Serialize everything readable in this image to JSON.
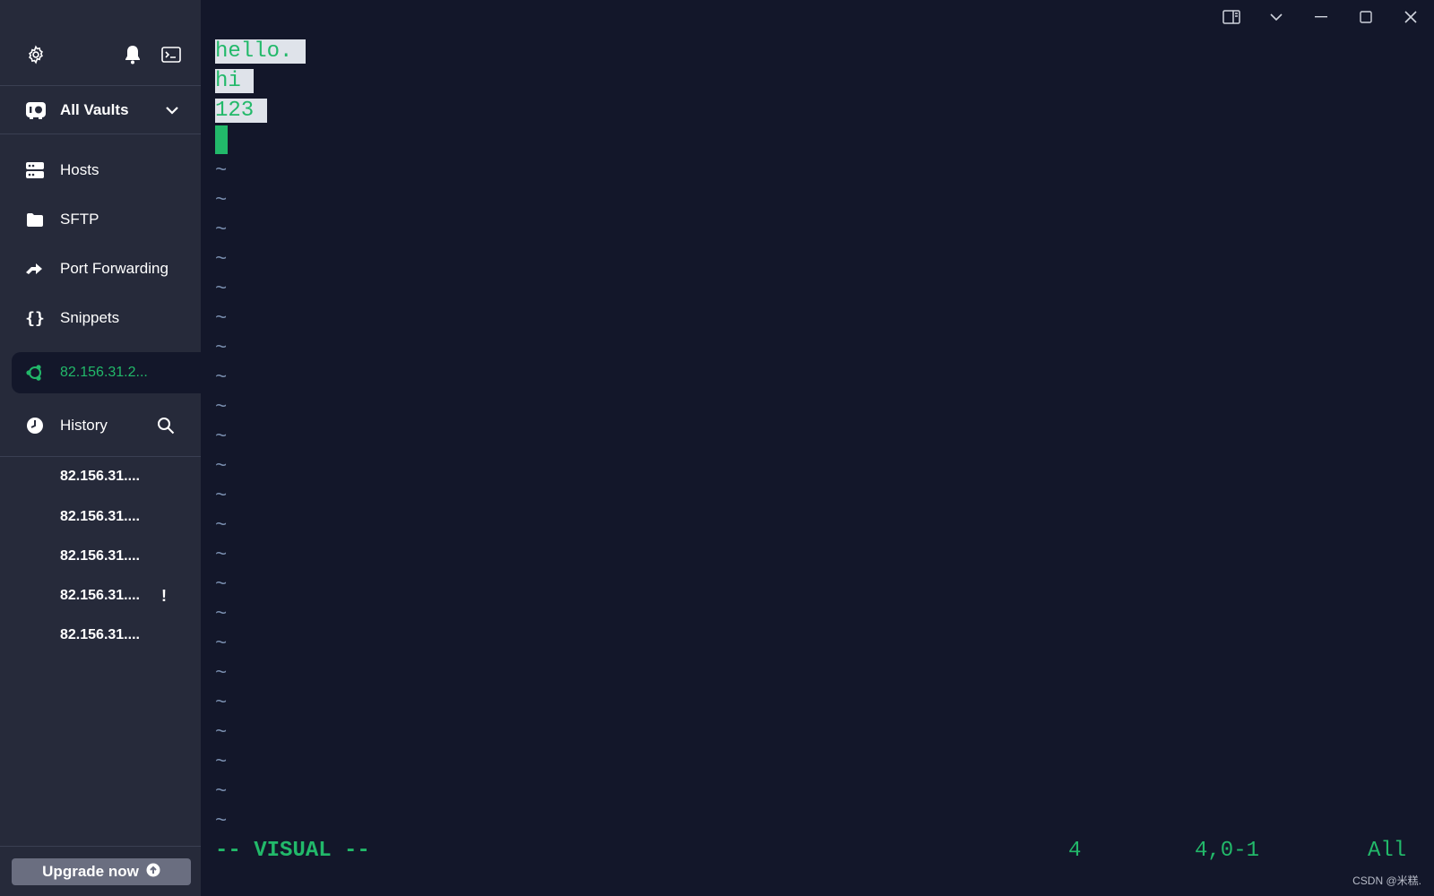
{
  "sidebar": {
    "vault_label": "All Vaults",
    "nav": [
      {
        "label": "Hosts",
        "icon": "hosts-icon"
      },
      {
        "label": "SFTP",
        "icon": "folder-icon"
      },
      {
        "label": "Port Forwarding",
        "icon": "port-forwarding-icon"
      },
      {
        "label": "Snippets",
        "icon": "braces-icon"
      }
    ],
    "active_session": "82.156.31.2...",
    "history_label": "History",
    "history_items": [
      "82.156.31....",
      "82.156.31....",
      "82.156.31....",
      "82.156.31....",
      "82.156.31...."
    ],
    "history_warning": "!",
    "upgrade_label": "Upgrade now"
  },
  "terminal": {
    "lines": [
      "hello.",
      "hi",
      "123"
    ],
    "tilde": "~",
    "mode": "-- VISUAL --",
    "selected_count": "4",
    "position": "4,0-1",
    "scroll": "All"
  },
  "watermark": "CSDN @米糕.",
  "colors": {
    "sidebar_bg": "#262a3a",
    "terminal_bg": "#13172a",
    "accent_green": "#22b96a",
    "tilde_blue": "#7a8fb0",
    "selection": "#dfe3ea"
  }
}
